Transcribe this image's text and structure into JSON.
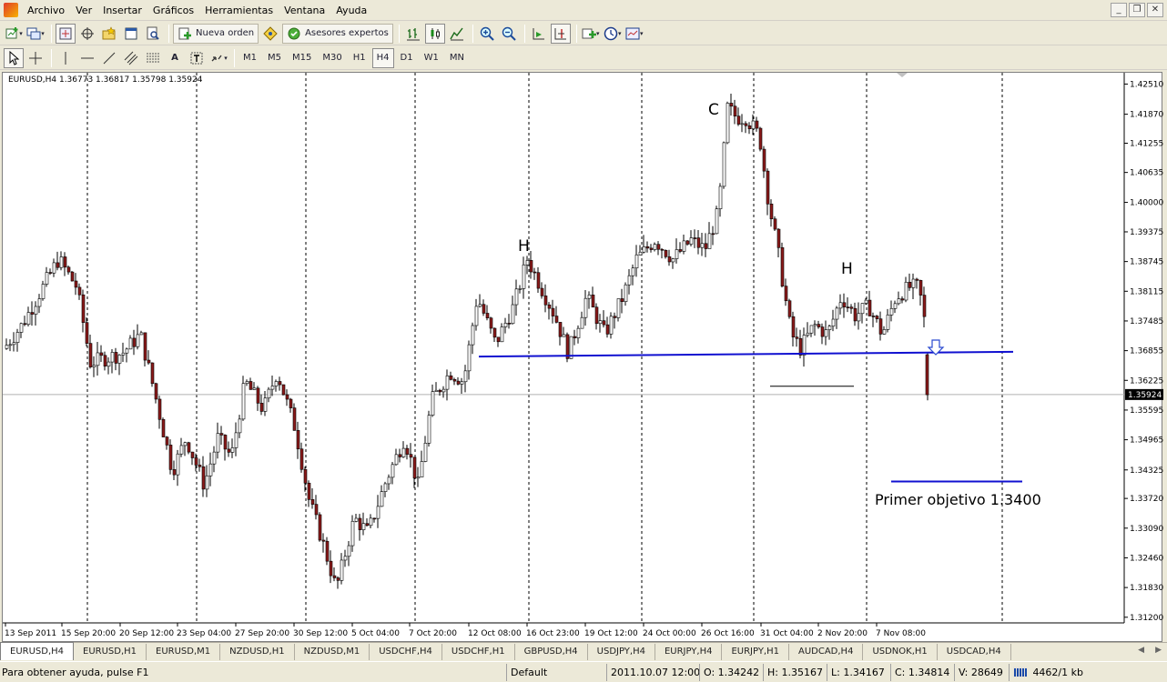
{
  "menu": [
    "Archivo",
    "Ver",
    "Insertar",
    "Gráficos",
    "Herramientas",
    "Ventana",
    "Ayuda"
  ],
  "toolbar": {
    "new_order_label": "Nueva orden",
    "experts_label": "Asesores expertos",
    "timeframes": [
      "M1",
      "M5",
      "M15",
      "M30",
      "H1",
      "H4",
      "D1",
      "W1",
      "MN"
    ],
    "active_timeframe": "H4"
  },
  "chart": {
    "header": "EURUSD,H4  1.36773 1.36817 1.35798 1.35924",
    "current_price_label": "1.35924",
    "annotation_target": "Primer objetivo 1.3400",
    "pattern_labels": [
      "H",
      "C",
      "H"
    ]
  },
  "chart_data": {
    "type": "candlestick",
    "symbol": "EURUSD",
    "timeframe": "H4",
    "ohlc_header": {
      "open": 1.36773,
      "high": 1.36817,
      "low": 1.35798,
      "close": 1.35924
    },
    "y_ticks": [
      1.4251,
      1.4187,
      1.41255,
      1.40635,
      1.4,
      1.39375,
      1.38745,
      1.38115,
      1.37485,
      1.36855,
      1.36225,
      1.35595,
      1.34965,
      1.34325,
      1.3372,
      1.3309,
      1.3246,
      1.3183,
      1.312
    ],
    "ylim": [
      1.3108,
      1.4275
    ],
    "x_labels": [
      "13 Sep 2011",
      "15 Sep 20:00",
      "20 Sep 12:00",
      "23 Sep 04:00",
      "27 Sep 20:00",
      "30 Sep 12:00",
      "5 Oct 04:00",
      "7 Oct 20:00",
      "12 Oct 08:00",
      "16 Oct 23:00",
      "19 Oct 12:00",
      "24 Oct 00:00",
      "26 Oct 16:00",
      "31 Oct 04:00",
      "2 Nov 20:00",
      "7 Nov 08:00"
    ],
    "anchors": [
      [
        0,
        1.369
      ],
      [
        20,
        1.374
      ],
      [
        60,
        1.388
      ],
      [
        80,
        1.382
      ],
      [
        95,
        1.366
      ],
      [
        130,
        1.368
      ],
      [
        150,
        1.372
      ],
      [
        165,
        1.36
      ],
      [
        185,
        1.343
      ],
      [
        200,
        1.35
      ],
      [
        220,
        1.34
      ],
      [
        235,
        1.35
      ],
      [
        250,
        1.346
      ],
      [
        265,
        1.362
      ],
      [
        285,
        1.356
      ],
      [
        300,
        1.364
      ],
      [
        320,
        1.352
      ],
      [
        335,
        1.337
      ],
      [
        350,
        1.328
      ],
      [
        365,
        1.318
      ],
      [
        385,
        1.333
      ],
      [
        400,
        1.33
      ],
      [
        420,
        1.341
      ],
      [
        440,
        1.35
      ],
      [
        455,
        1.34
      ],
      [
        470,
        1.358
      ],
      [
        490,
        1.364
      ],
      [
        505,
        1.362
      ],
      [
        520,
        1.38
      ],
      [
        540,
        1.37
      ],
      [
        560,
        1.378
      ],
      [
        575,
        1.388
      ],
      [
        590,
        1.382
      ],
      [
        605,
        1.376
      ],
      [
        620,
        1.368
      ],
      [
        640,
        1.38
      ],
      [
        660,
        1.372
      ],
      [
        680,
        1.38
      ],
      [
        695,
        1.388
      ],
      [
        715,
        1.392
      ],
      [
        735,
        1.388
      ],
      [
        755,
        1.392
      ],
      [
        770,
        1.39
      ],
      [
        785,
        1.398
      ],
      [
        795,
        1.42
      ],
      [
        805,
        1.418
      ],
      [
        815,
        1.418
      ],
      [
        830,
        1.414
      ],
      [
        840,
        1.4
      ],
      [
        850,
        1.39
      ],
      [
        858,
        1.38
      ],
      [
        865,
        1.372
      ],
      [
        875,
        1.369
      ],
      [
        890,
        1.374
      ],
      [
        905,
        1.372
      ],
      [
        920,
        1.38
      ],
      [
        935,
        1.376
      ],
      [
        950,
        1.378
      ],
      [
        965,
        1.372
      ],
      [
        980,
        1.38
      ],
      [
        995,
        1.382
      ],
      [
        1005,
        1.382
      ],
      [
        1012,
        1.374
      ],
      [
        1016,
        1.358
      ]
    ],
    "neckline": {
      "start": [
        523,
        1.3673
      ],
      "end": [
        1110,
        1.3683
      ]
    },
    "support_segment": {
      "start": [
        843,
        1.361
      ],
      "end": [
        935,
        1.361
      ]
    },
    "target_line": {
      "start": [
        976,
        1.3408
      ],
      "end": [
        1120,
        1.3408
      ]
    },
    "current_price": 1.35924,
    "pattern": "head-and-shoulders",
    "colors": {
      "bull": "#000000",
      "bear": "#8b1a1a",
      "neckline": "#1010d0",
      "target": "#1010d0",
      "grid": "#000000",
      "price_line": "#b0b0b0"
    }
  },
  "tabs": [
    "EURUSD,H4",
    "EURUSD,H1",
    "EURUSD,M1",
    "NZDUSD,H1",
    "NZDUSD,M1",
    "USDCHF,H4",
    "USDCHF,H1",
    "GBPUSD,H4",
    "USDJPY,H4",
    "EURJPY,H4",
    "EURJPY,H1",
    "AUDCAD,H4",
    "USDNOK,H1",
    "USDCAD,H4"
  ],
  "status": {
    "help": "Para obtener ayuda, pulse F1",
    "profile": "Default",
    "datetime": "2011.10.07 12:00",
    "open": "O: 1.34242",
    "high": "H: 1.35167",
    "low": "L: 1.34167",
    "close": "C: 1.34814",
    "volume": "V: 28649",
    "traffic": "4462/1 kb"
  }
}
